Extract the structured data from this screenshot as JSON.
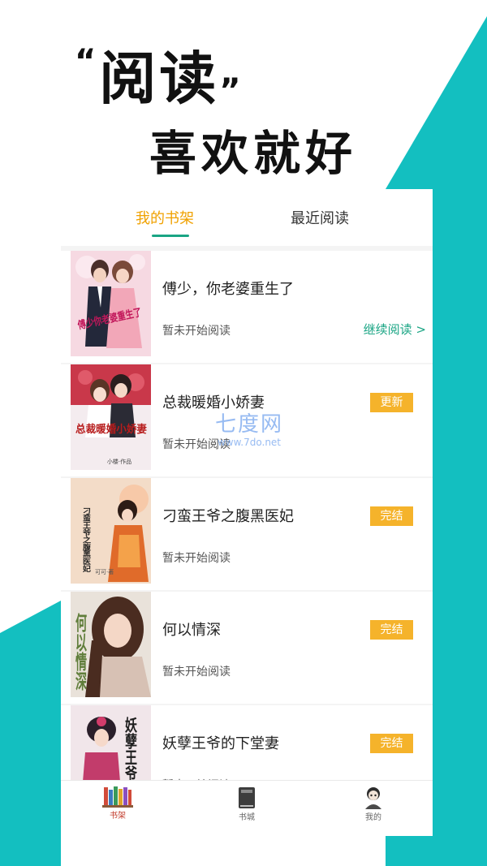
{
  "colors": {
    "accent_teal": "#13bfc0",
    "tab_active": "#f0a100",
    "underline": "#1aa584",
    "badge": "#f5b32b",
    "continue_link": "#1aa584"
  },
  "promo": {
    "open_quote": "“",
    "headline1": "阅读",
    "close_quote": "”",
    "headline2": "喜欢就好"
  },
  "tabs": [
    {
      "label": "我的书架",
      "active": true
    },
    {
      "label": "最近阅读",
      "active": false
    }
  ],
  "books": [
    {
      "title": "傅少，你老婆重生了",
      "status": "暂未开始阅读",
      "action": "继续阅读 >",
      "badge": ""
    },
    {
      "title": "总裁暖婚小娇妻",
      "status": "暂未开始阅读",
      "action": "",
      "badge": "更新"
    },
    {
      "title": "刁蛮王爷之腹黑医妃",
      "status": "暂未开始阅读",
      "action": "",
      "badge": "完结"
    },
    {
      "title": "何以情深",
      "status": "暂未开始阅读",
      "action": "",
      "badge": "完结"
    },
    {
      "title": "妖孽王爷的下堂妻",
      "status": "暂未开始阅读",
      "action": "",
      "badge": "完结"
    }
  ],
  "covers": [
    {
      "text": "傅少你老婆重生了",
      "sub": ""
    },
    {
      "text": "总裁暖婚小娇妻",
      "sub": "小楼·作品"
    },
    {
      "text": "刁蛮王爷之腹黑医妃",
      "sub": "可可·著"
    },
    {
      "text": "何以情深",
      "sub": ""
    },
    {
      "text": "妖孽王爷",
      "sub": ""
    }
  ],
  "bottom_nav": [
    {
      "label": "书架",
      "icon": "bookshelf-icon",
      "active": true
    },
    {
      "label": "书城",
      "icon": "book-icon",
      "active": false
    },
    {
      "label": "我的",
      "icon": "user-icon",
      "active": false
    }
  ],
  "watermark": {
    "title": "七度网",
    "url": "www.7do.net"
  }
}
